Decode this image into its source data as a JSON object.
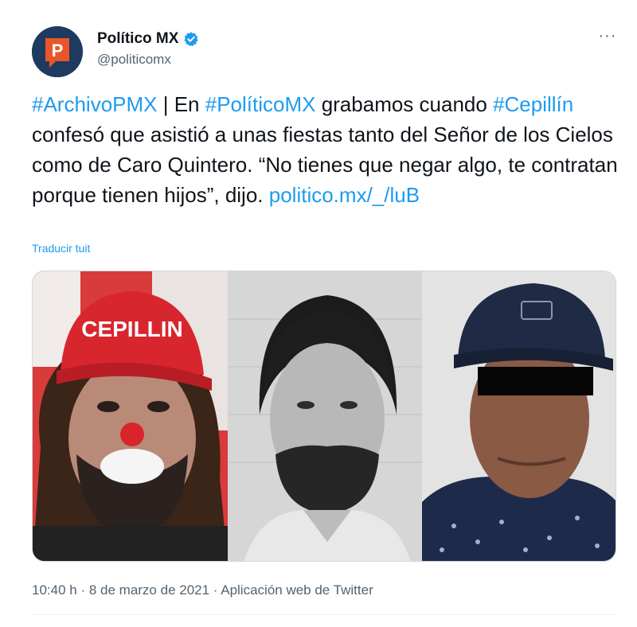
{
  "account": {
    "display_name": "Político MX",
    "handle": "@politicomx",
    "avatar_letter": "P",
    "avatar_colors": {
      "bg": "#1f3a5f",
      "badge": "#e8562a"
    },
    "verified_color": "#1d9bf0"
  },
  "menu": {
    "more_label": "···"
  },
  "tweet": {
    "segments": [
      {
        "text": "#ArchivoPMX",
        "link": true
      },
      {
        "text": " | En ",
        "link": false
      },
      {
        "text": "#PolíticoMX",
        "link": true
      },
      {
        "text": " grabamos cuando ",
        "link": false
      },
      {
        "text": "#Cepillín",
        "link": true
      },
      {
        "text": " confesó que asistió a unas fiestas tanto del Señor de los Cielos como de Caro Quintero. “No tienes que negar algo, te contratan porque tienen hijos”, dijo. ",
        "link": false
      },
      {
        "text": "politico.mx/_/luB",
        "link": true
      }
    ],
    "translate_label": "Traducir tuit"
  },
  "media": {
    "cap_text": "CEPILLIN"
  },
  "footer": {
    "time": "10:40 h",
    "sep1": " · ",
    "date": "8 de marzo de 2021",
    "sep2": " · ",
    "source": "Aplicación web de Twitter"
  },
  "colors": {
    "link": "#1d9bf0",
    "text": "#0f1419",
    "secondary": "#536471"
  }
}
